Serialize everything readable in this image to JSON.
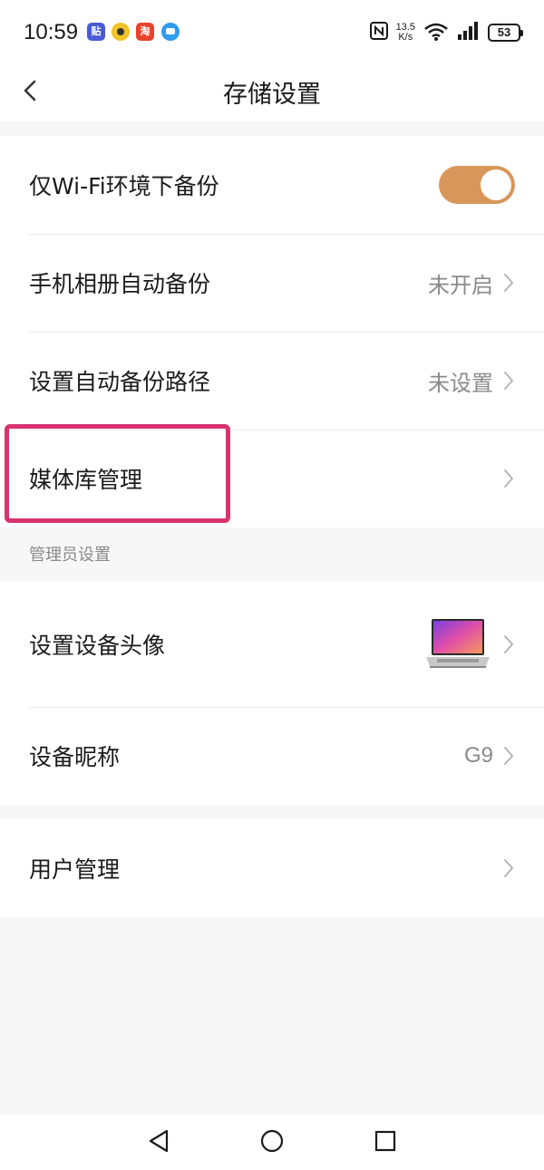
{
  "status_bar": {
    "time": "10:59",
    "network_speed_value": "13.5",
    "network_speed_unit": "K/s",
    "battery": "53",
    "app_icons": [
      "tieba-icon",
      "yellow-app-icon",
      "taobao-icon",
      "messages-icon"
    ],
    "signal_icons": [
      "nfc-icon",
      "wifi-6-icon",
      "cell-signal-icon"
    ]
  },
  "header": {
    "title": "存储设置",
    "back_icon": "chevron-left-icon"
  },
  "backup_section": {
    "wifi_only": {
      "label": "仅Wi-Fi环境下备份",
      "enabled": true,
      "toggle_color": "#d9965a"
    },
    "album_backup": {
      "label": "手机相册自动备份",
      "value": "未开启"
    },
    "backup_path": {
      "label": "设置自动备份路径",
      "value": "未设置"
    },
    "media_library": {
      "label": "媒体库管理"
    }
  },
  "admin_section": {
    "header": "管理员设置",
    "device_avatar": {
      "label": "设置设备头像",
      "image_icon": "laptop-image"
    },
    "device_nickname": {
      "label": "设备昵称",
      "value": "G9"
    }
  },
  "user_section": {
    "user_management": {
      "label": "用户管理"
    }
  },
  "highlight_color": "#d8336f",
  "nav_bar": {
    "buttons": [
      "back-triangle-icon",
      "home-circle-icon",
      "recents-square-icon"
    ]
  }
}
